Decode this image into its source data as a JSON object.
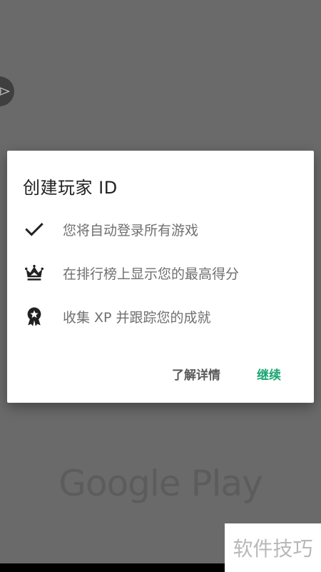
{
  "dialog": {
    "title": "创建玩家 ID",
    "features": [
      {
        "icon": "check-icon",
        "text": "您将自动登录所有游戏"
      },
      {
        "icon": "crown-icon",
        "text": "在排行榜上显示您的最高得分"
      },
      {
        "icon": "award-badge-icon",
        "text": "收集 XP 并跟踪您的成就"
      }
    ],
    "buttons": {
      "learn_more": "了解详情",
      "continue": "继续"
    }
  },
  "background": {
    "brand_text": "Google Play",
    "side_button_icon": "send-icon"
  },
  "watermark": {
    "text": "软件技巧"
  },
  "colors": {
    "accent": "#1aa672",
    "scrim": "#6a6a6a",
    "icon": "#212121"
  }
}
